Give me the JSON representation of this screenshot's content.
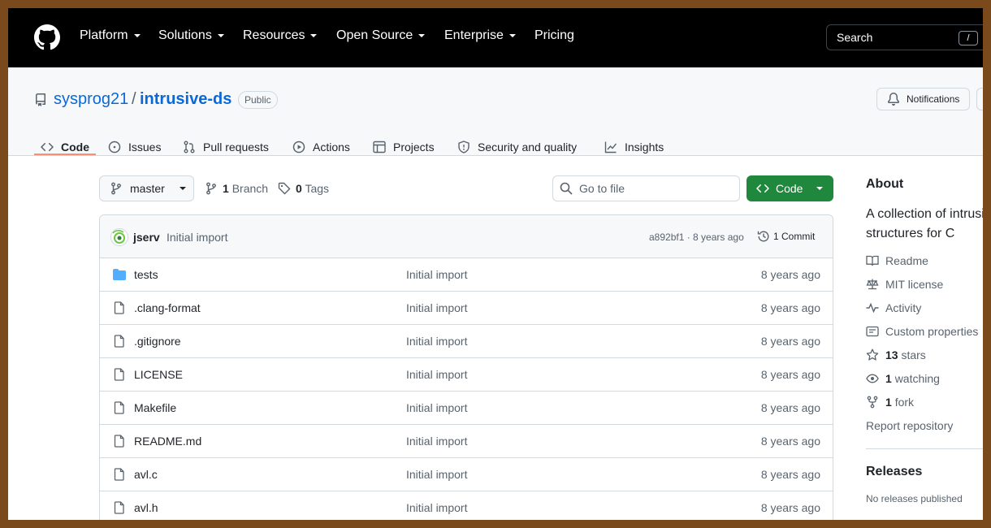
{
  "nav": {
    "items": [
      "Platform",
      "Solutions",
      "Resources",
      "Open Source",
      "Enterprise",
      "Pricing"
    ],
    "search_label": "Search",
    "search_key": "/"
  },
  "repo": {
    "owner": "sysprog21",
    "separator": "/",
    "name": "intrusive-ds",
    "visibility": "Public",
    "notifications_label": "Notifications"
  },
  "tabs": [
    "Code",
    "Issues",
    "Pull requests",
    "Actions",
    "Projects",
    "Security and quality",
    "Insights"
  ],
  "toolbar": {
    "branch": "master",
    "branch_count": "1",
    "branch_label": "Branch",
    "tag_count": "0",
    "tag_label": "Tags",
    "go_to_file": "Go to file",
    "code_button": "Code"
  },
  "commit": {
    "author": "jserv",
    "message": "Initial import",
    "hash_age": "a892bf1 · 8 years ago",
    "commits": "1 Commit"
  },
  "files": [
    {
      "name": "tests",
      "type": "dir",
      "message": "Initial import",
      "age": "8 years ago"
    },
    {
      "name": ".clang-format",
      "type": "file",
      "message": "Initial import",
      "age": "8 years ago"
    },
    {
      "name": ".gitignore",
      "type": "file",
      "message": "Initial import",
      "age": "8 years ago"
    },
    {
      "name": "LICENSE",
      "type": "file",
      "message": "Initial import",
      "age": "8 years ago"
    },
    {
      "name": "Makefile",
      "type": "file",
      "message": "Initial import",
      "age": "8 years ago"
    },
    {
      "name": "README.md",
      "type": "file",
      "message": "Initial import",
      "age": "8 years ago"
    },
    {
      "name": "avl.c",
      "type": "file",
      "message": "Initial import",
      "age": "8 years ago"
    },
    {
      "name": "avl.h",
      "type": "file",
      "message": "Initial import",
      "age": "8 years ago"
    }
  ],
  "about": {
    "title": "About",
    "description_line1": "A collection of intrusi",
    "description_line2": "structures for C",
    "readme": "Readme",
    "license": "MIT license",
    "activity": "Activity",
    "custom_properties": "Custom properties",
    "stars_count": "13",
    "stars_label": "stars",
    "watching_count": "1",
    "watching_label": "watching",
    "fork_count": "1",
    "fork_label": "fork",
    "report": "Report repository"
  },
  "releases": {
    "title": "Releases",
    "none": "No releases published"
  },
  "colors": {
    "accent_link": "#0969da",
    "code_button": "#1f883d",
    "tab_underline": "#fd8c73",
    "folder": "#54aeff"
  }
}
